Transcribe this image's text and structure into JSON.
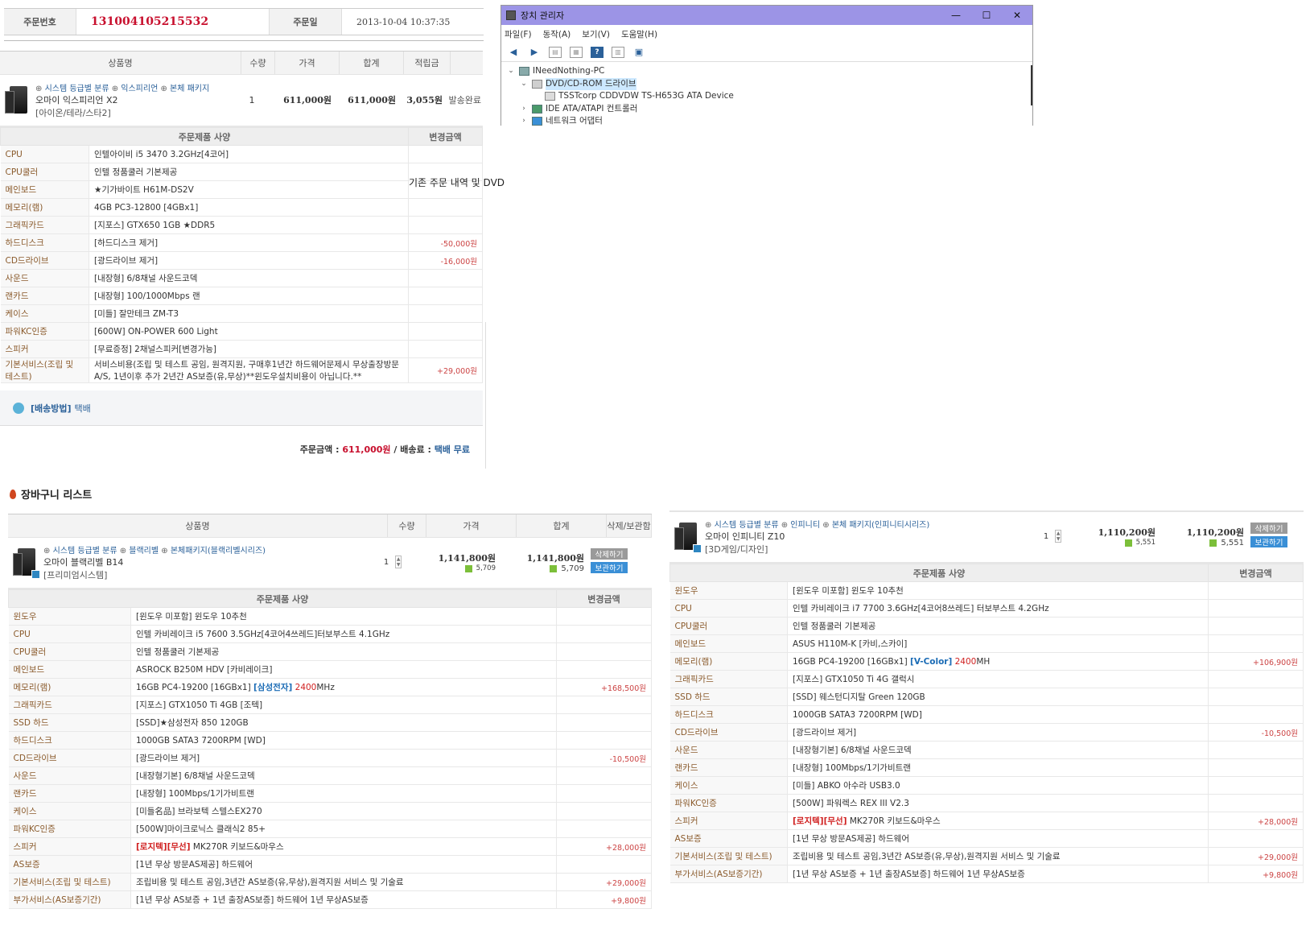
{
  "order": {
    "order_no_label": "주문번호",
    "order_no": "131004105215532",
    "order_date_label": "주문일",
    "order_date": "2013-10-04 10:37:35",
    "columns": [
      "상품명",
      "수량",
      "가격",
      "합계",
      "적립금"
    ],
    "product": {
      "cat1": "시스템 등급별 분류",
      "cat2": "익스피리언",
      "cat3": "본체 패키지",
      "name": "오마이 익스피리언 X2",
      "sub": "[아이온/테라/스타2]",
      "qty": "1",
      "price": "611,000원",
      "total": "611,000원",
      "points": "3,055원",
      "status": "발송완료"
    },
    "spec_header": "주문제품 사양",
    "change_header": "변경금액",
    "specs": [
      {
        "k": "CPU",
        "v": "인텔아이비 i5 3470 3.2GHz[4코어]",
        "p": ""
      },
      {
        "k": "CPU쿨러",
        "v": "인텔 정품쿨러 기본제공",
        "p": ""
      },
      {
        "k": "메인보드",
        "v": "★기가바이트 H61M-DS2V",
        "p": ""
      },
      {
        "k": "메모리(램)",
        "v": "4GB PC3-12800 [4GBx1]",
        "p": ""
      },
      {
        "k": "그래픽카드",
        "v": "[지포스] GTX650 1GB ★DDR5",
        "p": ""
      },
      {
        "k": "하드디스크",
        "v": "[하드디스크 제거]",
        "p": "-50,000원"
      },
      {
        "k": "CD드라이브",
        "v": "[광드라이브 제거]",
        "p": "-16,000원"
      },
      {
        "k": "사운드",
        "v": "[내장형] 6/8채널 사운드코덱",
        "p": ""
      },
      {
        "k": "랜카드",
        "v": "[내장형] 100/1000Mbps 랜",
        "p": ""
      },
      {
        "k": "케이스",
        "v": "[미들] 잘만테크 ZM-T3",
        "p": ""
      },
      {
        "k": "파워KC인증",
        "v": "[600W] ON-POWER 600 Light",
        "p": ""
      },
      {
        "k": "스피커",
        "v": "[무료증정] 2채널스피커[변경가능]",
        "p": ""
      },
      {
        "k": "기본서비스(조립 및 테스트)",
        "v": "서비스비용(조립 및 테스트 공임, 원격지원, 구매후1년간 하드웨어문제시 무상출장방문A/S, 1년이후 추가 2년간 AS보증(유,무상)**윈도우설치비용이 아닙니다.**",
        "p": "+29,000원"
      }
    ],
    "ship_label": "[배송방법]",
    "ship_value": "택배",
    "total_label": "주문금액 :",
    "total_amount": "611,000원",
    "fee_label": "/ 배송료 :",
    "fee_value": "택배 무료"
  },
  "devmgr": {
    "title": "장치 관리자",
    "menu": [
      "파일(F)",
      "동작(A)",
      "보기(V)",
      "도움말(H)"
    ],
    "tree": {
      "root": "INeedNothing-PC",
      "dvd": "DVD/CD-ROM 드라이브",
      "dvd_dev": "TSSTcorp CDDVDW TS-H653G ATA Device",
      "ide": "IDE ATA/ATAPI 컨트롤러",
      "net": "네트워크 어댑터"
    }
  },
  "note": "기존 주문 내역 및 DVD",
  "cart": {
    "title": "장바구니 리스트",
    "columns": [
      "상품명",
      "수량",
      "가격",
      "합계",
      "삭제/보관함"
    ],
    "del_label": "삭제하기",
    "save_label": "보관하기",
    "spec_header": "주문제품 사양",
    "change_header": "변경금액",
    "items": [
      {
        "cat1": "시스템 등급별 분류",
        "cat2": "블랙리벨",
        "cat3": "본체패키지(블랙리벨시리즈)",
        "name": "오마이 블랙리벨 B14",
        "sub": "[프리미엄시스템]",
        "qty": "1",
        "price": "1,141,800원",
        "total": "1,141,800원",
        "pts1": "5,709",
        "pts2": "5,709",
        "specs": [
          {
            "k": "윈도우",
            "v": "[윈도우 미포함] 윈도우 10추천",
            "p": ""
          },
          {
            "k": "CPU",
            "v": "인텔 카비레이크 i5 7600 3.5GHz[4코어4쓰레드]터보부스트 4.1GHz",
            "p": ""
          },
          {
            "k": "CPU쿨러",
            "v": "인텔 정품쿨러 기본제공",
            "p": ""
          },
          {
            "k": "메인보드",
            "v": "ASROCK B250M HDV [카비레이크]",
            "p": ""
          },
          {
            "k": "메모리(램)",
            "v": "16GB PC4-19200 [16GBx1]",
            "v2": "[삼성전자]",
            "v3": "2400",
            "v4": "MHz",
            "p": "+168,500원"
          },
          {
            "k": "그래픽카드",
            "v": "[지포스] GTX1050 Ti 4GB [조텍]",
            "p": ""
          },
          {
            "k": "SSD 하드",
            "v": "[SSD]★삼성전자 850 120GB",
            "p": ""
          },
          {
            "k": "하드디스크",
            "v": "1000GB SATA3 7200RPM [WD]",
            "p": ""
          },
          {
            "k": "CD드라이브",
            "v": "[광드라이브 제거]",
            "p": "-10,500원"
          },
          {
            "k": "사운드",
            "v": "[내장형기본] 6/8채널 사운드코덱",
            "p": ""
          },
          {
            "k": "랜카드",
            "v": "[내장형] 100Mbps/1기가비트랜",
            "p": ""
          },
          {
            "k": "케이스",
            "v": "[미들名品] 브라보텍 스텔스EX270",
            "p": ""
          },
          {
            "k": "파워KC인증",
            "v": "[500W]마이크로닉스 클래식2 85+",
            "p": ""
          },
          {
            "k": "스피커",
            "v": "[로지텍][무선]",
            "v2": "MK270R 키보드&마우스",
            "p": "+28,000원"
          },
          {
            "k": "AS보증",
            "v": "[1년 무상 방문AS제공] 하드웨어",
            "p": ""
          },
          {
            "k": "기본서비스(조립 및 테스트)",
            "v": "조립비용 및 테스트 공임,3년간 AS보증(유,무상),원격지원 서비스 및 기술료",
            "p": "+29,000원"
          },
          {
            "k": "부가서비스(AS보증기간)",
            "v": "[1년 무상 AS보증 + 1년 출장AS보증] 하드웨어 1년 무상AS보증",
            "p": "+9,800원"
          }
        ]
      },
      {
        "cat1": "시스템 등급별 분류",
        "cat2": "인피니티",
        "cat3": "본체 패키지(인피니티시리즈)",
        "name": "오마이 인피니티 Z10",
        "sub": "[3D게임/디자인]",
        "qty": "1",
        "price": "1,110,200원",
        "total": "1,110,200원",
        "pts1": "5,551",
        "pts2": "5,551",
        "specs": [
          {
            "k": "윈도우",
            "v": "[윈도우 미포함] 윈도우 10추천",
            "p": ""
          },
          {
            "k": "CPU",
            "v": "인텔 카비레이크 i7 7700 3.6GHz[4코어8쓰레드] 터보부스트 4.2GHz",
            "p": ""
          },
          {
            "k": "CPU쿨러",
            "v": "인텔 정품쿨러 기본제공",
            "p": ""
          },
          {
            "k": "메인보드",
            "v": "ASUS H110M-K [카비,스카이]",
            "p": ""
          },
          {
            "k": "메모리(램)",
            "v": "16GB PC4-19200 [16GBx1]",
            "v2": "[V-Color]",
            "v3": "2400",
            "v4": "MH",
            "p": "+106,900원"
          },
          {
            "k": "그래픽카드",
            "v": "[지포스] GTX1050 Ti 4G 갤럭시",
            "p": ""
          },
          {
            "k": "SSD 하드",
            "v": "[SSD] 웨스턴디지탈 Green 120GB",
            "p": ""
          },
          {
            "k": "하드디스크",
            "v": "1000GB SATA3 7200RPM [WD]",
            "p": ""
          },
          {
            "k": "CD드라이브",
            "v": "[광드라이브 제거]",
            "p": "-10,500원"
          },
          {
            "k": "사운드",
            "v": "[내장형기본] 6/8채널 사운드코덱",
            "p": ""
          },
          {
            "k": "랜카드",
            "v": "[내장형] 100Mbps/1기가비트랜",
            "p": ""
          },
          {
            "k": "케이스",
            "v": "[미들] ABKO 아수라 USB3.0",
            "p": ""
          },
          {
            "k": "파워KC인증",
            "v": "[500W] 파워렉스 REX III V2.3",
            "p": ""
          },
          {
            "k": "스피커",
            "v": "[로지텍][무선]",
            "v2": "MK270R 키보드&마우스",
            "p": "+28,000원"
          },
          {
            "k": "AS보증",
            "v": "[1년 무상 방문AS제공] 하드웨어",
            "p": ""
          },
          {
            "k": "기본서비스(조립 및 테스트)",
            "v": "조립비용 및 테스트 공임,3년간 AS보증(유,무상),원격지원 서비스 및 기술료",
            "p": "+29,000원"
          },
          {
            "k": "부가서비스(AS보증기간)",
            "v": "[1년 무상 AS보증 + 1년 출장AS보증] 하드웨어 1년 무상AS보증",
            "p": "+9,800원"
          }
        ]
      }
    ]
  }
}
